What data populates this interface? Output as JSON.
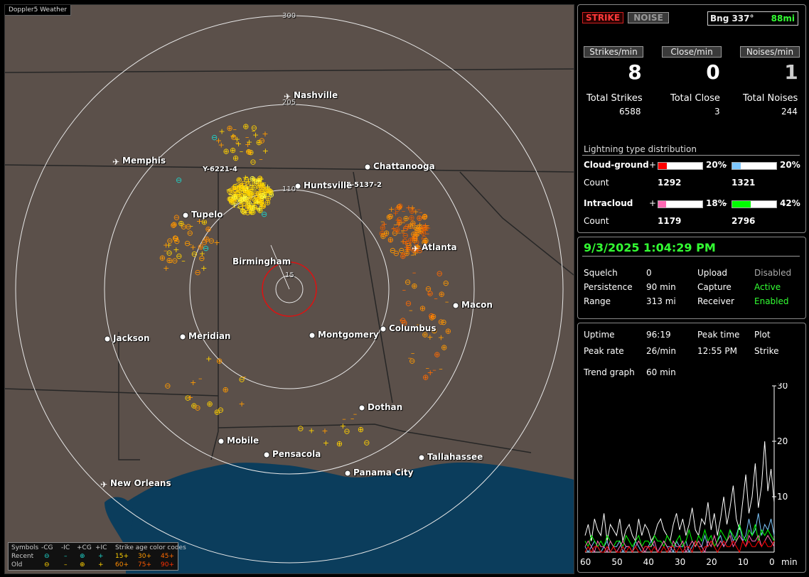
{
  "map": {
    "brand": "Doppler5 Weather",
    "ring_labels": [
      "300",
      "205",
      "110",
      "15"
    ],
    "cities": [
      {
        "name": "Nashville",
        "airport": true
      },
      {
        "name": "Memphis",
        "airport": true
      },
      {
        "name": "Chattanooga",
        "airport": false
      },
      {
        "name": "Huntsville",
        "airport": false
      },
      {
        "name": "Tupelo",
        "airport": false
      },
      {
        "name": "Birmingham",
        "airport": false
      },
      {
        "name": "Atlanta",
        "airport": true
      },
      {
        "name": "Macon",
        "airport": false
      },
      {
        "name": "Jackson",
        "airport": false
      },
      {
        "name": "Meridian",
        "airport": false
      },
      {
        "name": "Montgomery",
        "airport": false
      },
      {
        "name": "Columbus",
        "airport": false
      },
      {
        "name": "Dothan",
        "airport": false
      },
      {
        "name": "Mobile",
        "airport": false
      },
      {
        "name": "Pensacola",
        "airport": false
      },
      {
        "name": "Tallahassee",
        "airport": false
      },
      {
        "name": "Panama City",
        "airport": false
      },
      {
        "name": "New Orleans",
        "airport": true
      }
    ],
    "cell_labels": [
      "Y-6221-4",
      "E-5137-2"
    ],
    "legend": {
      "symbols_label": "Symbols",
      "cols": [
        "-CG",
        "-IC",
        "+CG",
        "+IC"
      ],
      "age_label": "Strike age color codes",
      "recent_label": "Recent",
      "old_label": "Old",
      "recent_ages": [
        "15+",
        "30+",
        "45+"
      ],
      "old_ages": [
        "60+",
        "75+",
        "90+"
      ],
      "age_colors": [
        "#ffd000",
        "#ff9a00",
        "#ff6a00",
        "#ff8c00",
        "#ff5a00",
        "#ff3000"
      ]
    }
  },
  "status": {
    "strike_btn": "STRIKE",
    "noise_btn": "NOISE",
    "bearing": "Bng 337°",
    "distance": "88mi",
    "strikes_min_label": "Strikes/min",
    "close_min_label": "Close/min",
    "noises_min_label": "Noises/min",
    "strikes_min": "8",
    "close_min": "0",
    "noises_min": "1",
    "total_strikes_label": "Total Strikes",
    "total_close_label": "Total Close",
    "total_noises_label": "Total Noises",
    "total_strikes": "6588",
    "total_close": "3",
    "total_noises": "244",
    "dist_title": "Lightning type distribution",
    "cg_label": "Cloud-ground",
    "ic_label": "Intracloud",
    "count_label": "Count",
    "plus": "+",
    "minus": "–",
    "cg_pos_pct": "20%",
    "cg_neg_pct": "20%",
    "ic_pos_pct": "18%",
    "ic_neg_pct": "42%",
    "cg_pos_count": "1292",
    "cg_neg_count": "1321",
    "ic_pos_count": "1179",
    "ic_neg_count": "2796",
    "cg_pos_frac": 0.2,
    "cg_neg_frac": 0.2,
    "ic_pos_frac": 0.18,
    "ic_neg_frac": 0.42,
    "colors": {
      "cg_pos": "#ff0000",
      "cg_neg": "#7ec8ff",
      "ic_pos": "#ff69b4",
      "ic_neg": "#00ff00"
    }
  },
  "settings": {
    "datetime": "9/3/2025 1:04:29 PM",
    "squelch_label": "Squelch",
    "squelch": "0",
    "persistence_label": "Persistence",
    "persistence": "90 min",
    "range_label": "Range",
    "range": "313 mi",
    "upload_label": "Upload",
    "upload": "Disabled",
    "capture_label": "Capture",
    "capture": "Active",
    "receiver_label": "Receiver",
    "receiver": "Enabled"
  },
  "stats": {
    "uptime_label": "Uptime",
    "uptime": "96:19",
    "peak_time_label": "Peak time",
    "plot_label": "Plot",
    "peak_rate_label": "Peak rate",
    "peak_rate": "26/min",
    "peak_time": "12:55 PM",
    "plot": "Strike",
    "trend_label": "Trend graph",
    "trend": "60 min"
  },
  "chart_data": {
    "type": "line",
    "xlabel": "min",
    "x_ticks": [
      "60",
      "50",
      "40",
      "30",
      "20",
      "10",
      "0"
    ],
    "y_ticks": [
      "30",
      "20",
      "10"
    ],
    "ylim": [
      0,
      30
    ],
    "xlim": [
      60,
      0
    ],
    "series": [
      {
        "color": "#ffffff",
        "values": [
          3,
          5,
          2,
          6,
          4,
          3,
          7,
          2,
          5,
          4,
          3,
          6,
          2,
          4,
          5,
          3,
          2,
          6,
          3,
          5,
          4,
          2,
          3,
          5,
          6,
          4,
          3,
          2,
          5,
          7,
          4,
          6,
          3,
          5,
          8,
          4,
          3,
          6,
          5,
          9,
          4,
          7,
          3,
          6,
          10,
          5,
          8,
          12,
          6,
          4,
          9,
          14,
          7,
          10,
          16,
          8,
          12,
          20,
          11,
          15,
          9
        ]
      },
      {
        "color": "#7ec8ff",
        "values": [
          1,
          0,
          1,
          2,
          1,
          0,
          1,
          2,
          0,
          1,
          1,
          2,
          0,
          1,
          1,
          0,
          2,
          1,
          0,
          1,
          1,
          2,
          1,
          0,
          1,
          2,
          1,
          1,
          0,
          2,
          1,
          1,
          2,
          0,
          1,
          2,
          1,
          1,
          3,
          1,
          2,
          1,
          2,
          3,
          1,
          2,
          4,
          2,
          3,
          5,
          2,
          3,
          6,
          3,
          4,
          7,
          3,
          5,
          4,
          6,
          3
        ]
      },
      {
        "color": "#00ff00",
        "values": [
          2,
          1,
          3,
          2,
          1,
          2,
          1,
          3,
          2,
          1,
          2,
          2,
          1,
          3,
          2,
          1,
          2,
          3,
          1,
          2,
          2,
          1,
          3,
          2,
          2,
          1,
          3,
          2,
          1,
          2,
          3,
          1,
          2,
          4,
          2,
          1,
          3,
          2,
          4,
          2,
          3,
          1,
          2,
          4,
          3,
          2,
          4,
          3,
          2,
          5,
          3,
          2,
          4,
          3,
          5,
          2,
          4,
          3,
          4,
          3,
          2
        ]
      },
      {
        "color": "#ff69b4",
        "values": [
          1,
          2,
          1,
          0,
          2,
          1,
          1,
          0,
          2,
          1,
          0,
          1,
          2,
          1,
          1,
          0,
          1,
          2,
          1,
          0,
          1,
          1,
          2,
          0,
          1,
          2,
          1,
          0,
          2,
          1,
          1,
          2,
          0,
          1,
          2,
          1,
          2,
          1,
          0,
          2,
          1,
          3,
          1,
          2,
          1,
          2,
          3,
          1,
          2,
          3,
          2,
          1,
          3,
          2,
          2,
          3,
          1,
          2,
          3,
          2,
          1
        ]
      },
      {
        "color": "#ff0000",
        "values": [
          0,
          1,
          0,
          1,
          1,
          0,
          0,
          1,
          0,
          1,
          0,
          0,
          1,
          0,
          1,
          0,
          1,
          0,
          0,
          1,
          1,
          0,
          1,
          0,
          0,
          1,
          0,
          1,
          1,
          0,
          1,
          0,
          1,
          1,
          0,
          2,
          1,
          0,
          1,
          1,
          2,
          1,
          0,
          1,
          2,
          1,
          1,
          2,
          1,
          0,
          2,
          1,
          2,
          1,
          1,
          2,
          1,
          2,
          1,
          1,
          2
        ]
      }
    ]
  }
}
